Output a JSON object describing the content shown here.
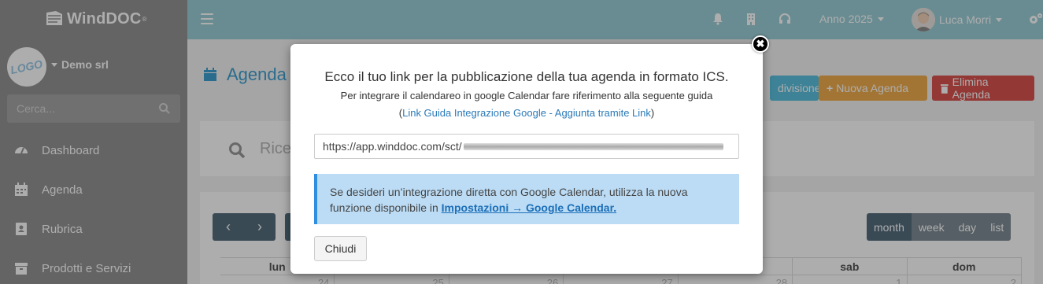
{
  "app": {
    "logo_text": "WindDOC",
    "logo_reg": "®"
  },
  "sidebar": {
    "company_logo": "LOGO",
    "company_name": "Demo srl",
    "search_placeholder": "Cerca...",
    "items": [
      {
        "label": "Dashboard",
        "icon": "dashboard-icon"
      },
      {
        "label": "Agenda",
        "icon": "calendar-icon"
      },
      {
        "label": "Rubrica",
        "icon": "address-book-icon"
      },
      {
        "label": "Prodotti e Servizi",
        "icon": "box-icon"
      }
    ]
  },
  "topbar": {
    "year": "Anno 2025",
    "user_name": "Luca Morri",
    "icons": [
      "menu-icon",
      "bell-icon",
      "building-icon",
      "headset-icon",
      "settings-icon"
    ]
  },
  "page": {
    "title": "Agenda",
    "buttons": {
      "share": "divisione",
      "new": "Nuova Agenda",
      "delete": "Elimina Agenda"
    },
    "search_text": "Rice",
    "calendar": {
      "views": [
        "month",
        "week",
        "day",
        "list"
      ],
      "active_view": "month",
      "day_headers": [
        "lun",
        "",
        "",
        "",
        "",
        "sab",
        "dom"
      ],
      "day_numbers": [
        "24",
        "25",
        "26",
        "27",
        "28",
        "1",
        "2"
      ]
    }
  },
  "modal": {
    "title": "Ecco il tuo link per la pubblicazione della tua agenda in formato ICS.",
    "subtitle": "Per integrare il calendareo in google Calendar fare riferimento alla seguente guida",
    "link_open": "(",
    "link_text": "Link Guida Integrazione Google - Aggiunta tramite Link",
    "link_close": ")",
    "url_value": "https://app.winddoc.com/sct/",
    "info_text": "Se desideri un’integrazione diretta con Google Calendar, utilizza la nuova funzione disponibile in ",
    "info_link": "Impostazioni → Google Calendar.",
    "close_button": "Chiudi",
    "close_x": "✖"
  },
  "colors": {
    "topbar": "#9bcfd8",
    "sidebar": "#949494",
    "accent": "#3fa0d0",
    "info_bg": "#bcdcf5",
    "info_border": "#2f8ee0"
  }
}
